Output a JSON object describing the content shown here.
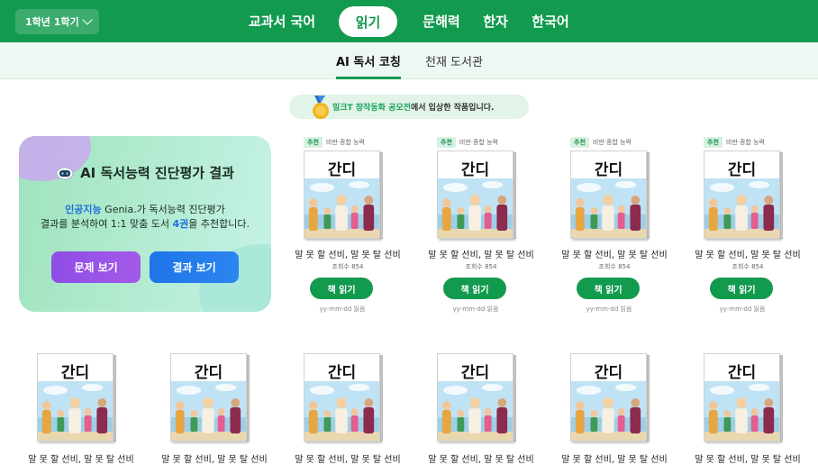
{
  "header": {
    "grade_select": "1학년 1학기",
    "nav": [
      {
        "label": "교과서 국어",
        "active": false
      },
      {
        "label": "읽기",
        "active": true
      },
      {
        "label": "문해력",
        "active": false
      },
      {
        "label": "한자",
        "active": false
      },
      {
        "label": "한국어",
        "active": false
      }
    ]
  },
  "subnav": [
    {
      "label": "AI 독서 코칭",
      "active": true
    },
    {
      "label": "천재 도서관",
      "active": false
    }
  ],
  "award": {
    "highlight": "밀크T 창작동화 공모전",
    "text": "에서 입상한 작품입니다."
  },
  "ai_card": {
    "title": "AI 독서능력 진단평가 결과",
    "desc_highlight": "인공지능",
    "desc_line1_rest": " Genia.가 독서능력 진단평가",
    "desc_line2_pre": "결과를 분석하여 1:1 맞춤 도서 ",
    "desc_count": "4권",
    "desc_line2_post": "을 추천합니다.",
    "btn_questions": "문제 보기",
    "btn_results": "결과 보기"
  },
  "recommended_books": [
    {
      "tag": "추천",
      "skill": "비판·종합 능력",
      "cover_title": "간디",
      "title": "말 못 할 선비, 말 못 탈 선비",
      "views": "조회수 854",
      "read_button": "책 읽기",
      "date": "yy-mm-dd 읽음"
    },
    {
      "tag": "추천",
      "skill": "비판·종합 능력",
      "cover_title": "간디",
      "title": "말 못 할 선비, 말 못 탈 선비",
      "views": "조회수 854",
      "read_button": "책 읽기",
      "date": "yy-mm-dd 읽음"
    },
    {
      "tag": "추천",
      "skill": "비판·종합 능력",
      "cover_title": "간디",
      "title": "말 못 할 선비, 말 못 탈 선비",
      "views": "조회수 854",
      "read_button": "책 읽기",
      "date": "yy-mm-dd 읽음"
    },
    {
      "tag": "추천",
      "skill": "비판·종합 능력",
      "cover_title": "간디",
      "title": "말 못 할 선비, 말 못 탈 선비",
      "views": "조회수 854",
      "read_button": "책 읽기",
      "date": "yy-mm-dd 읽음"
    }
  ],
  "books": [
    {
      "cover_title": "간디",
      "title": "말 못 할 선비, 말 못 탈 선비"
    },
    {
      "cover_title": "간디",
      "title": "말 못 할 선비, 말 못 탈 선비"
    },
    {
      "cover_title": "간디",
      "title": "말 못 할 선비, 말 못 탈 선비"
    },
    {
      "cover_title": "간디",
      "title": "말 못 할 선비, 말 못 탈 선비"
    },
    {
      "cover_title": "간디",
      "title": "말 못 할 선비, 말 못 탈 선비"
    },
    {
      "cover_title": "간디",
      "title": "말 못 할 선비, 말 못 탈 선비"
    }
  ],
  "colors": {
    "brand_green": "#129a4f",
    "subnav_bg": "#eef8f2",
    "purple_button": "#8f4de6",
    "blue_button": "#1f74e8"
  }
}
